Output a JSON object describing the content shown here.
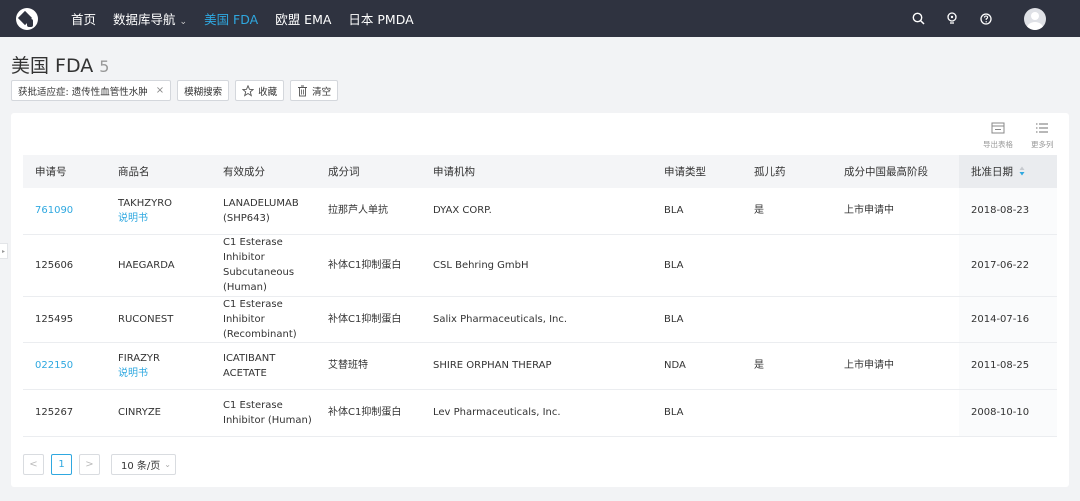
{
  "nav": {
    "items": [
      {
        "label": "首页",
        "active": false
      },
      {
        "label": "数据库导航",
        "active": false,
        "dropdown": true
      },
      {
        "label": "美国 FDA",
        "active": true
      },
      {
        "label": "欧盟 EMA",
        "active": false
      },
      {
        "label": "日本 PMDA",
        "active": false
      }
    ],
    "chevron": "⌄",
    "icons": [
      "search-icon",
      "bulb-icon",
      "help-icon",
      "avatar"
    ],
    "colors": {
      "bar": "#2f3340",
      "active": "#2fa8e0"
    }
  },
  "page": {
    "title": "美国 FDA",
    "count": "5"
  },
  "filters": {
    "indication_chip": "获批适应症: 遗传性血管性水肿",
    "close_glyph": "×",
    "fuzzy_search": "模糊搜索",
    "favorite": "收藏",
    "clear": "清空"
  },
  "toolbar": {
    "export": "导出表格",
    "more_columns": "更多列"
  },
  "table": {
    "headers": [
      "申请号",
      "商品名",
      "有效成分",
      "成分词",
      "申请机构",
      "申请类型",
      "孤儿药",
      "成分中国最高阶段",
      "批准日期"
    ],
    "rows": [
      {
        "app_no": "761090",
        "app_link": true,
        "trade": "TAKHZYRO",
        "label_link": "说明书",
        "ingredient": "LANADELUMAB (SHP643)",
        "word": "拉那芦人单抗",
        "org": "DYAX CORP.",
        "type": "BLA",
        "orphan": "是",
        "stage": "上市申请中",
        "date": "2018-08-23"
      },
      {
        "app_no": "125606",
        "app_link": false,
        "trade": "HAEGARDA",
        "label_link": "",
        "ingredient": "C1 Esterase Inhibitor Subcutaneous (Human)",
        "word": "补体C1抑制蛋白",
        "org": "CSL Behring GmbH",
        "type": "BLA",
        "orphan": "",
        "stage": "",
        "date": "2017-06-22"
      },
      {
        "app_no": "125495",
        "app_link": false,
        "trade": "RUCONEST",
        "label_link": "",
        "ingredient": "C1 Esterase Inhibitor (Recombinant)",
        "word": "补体C1抑制蛋白",
        "org": "Salix Pharmaceuticals, Inc.",
        "type": "BLA",
        "orphan": "",
        "stage": "",
        "date": "2014-07-16"
      },
      {
        "app_no": "022150",
        "app_link": true,
        "trade": "FIRAZYR",
        "label_link": "说明书",
        "ingredient": "ICATIBANT ACETATE",
        "word": "艾替班特",
        "org": "SHIRE ORPHAN THERAP",
        "type": "NDA",
        "orphan": "是",
        "stage": "上市申请中",
        "date": "2011-08-25"
      },
      {
        "app_no": "125267",
        "app_link": false,
        "trade": "CINRYZE",
        "label_link": "",
        "ingredient": "C1 Esterase Inhibitor (Human)",
        "word": "补体C1抑制蛋白",
        "org": "Lev Pharmaceuticals, Inc.",
        "type": "BLA",
        "orphan": "",
        "stage": "",
        "date": "2008-10-10"
      }
    ]
  },
  "pagination": {
    "prev": "<",
    "current": "1",
    "next": ">",
    "page_size": "10 条/页"
  }
}
